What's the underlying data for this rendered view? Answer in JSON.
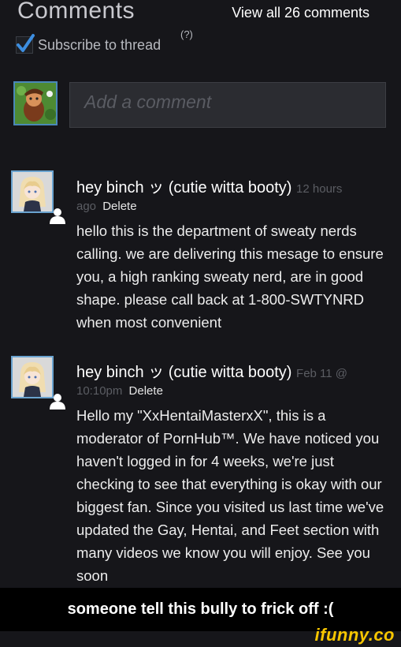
{
  "header": {
    "title": "Comments",
    "view_all": "View all 26 comments",
    "subscribe_label": "Subscribe to thread",
    "help": "(?)"
  },
  "composer": {
    "placeholder": "Add a comment"
  },
  "comments": [
    {
      "author": "hey binch ッ (cutie witta booty)",
      "timestamp_part1": "12 hours",
      "timestamp_part2": "ago",
      "delete_label": "Delete",
      "body": "hello this is the department of sweaty nerds calling. we are delivering this mesage to ensure you, a high ranking sweaty nerd, are in good shape. please call back at 1-800-SWTYNRD when most convenient"
    },
    {
      "author": "hey binch ッ (cutie witta booty)",
      "timestamp_part1": "Feb 11 @",
      "timestamp_part2": "10:10pm",
      "delete_label": "Delete",
      "body": "Hello my \"XxHentaiMasterxX\", this is a moderator of PornHub™. We have noticed you haven't logged in for 4 weeks, we're just checking to see that everything is okay with our biggest fan. Since you visited us last time we've updated the Gay, Hentai, and Feet section with many videos we know you will enjoy. See you soon"
    }
  ],
  "caption": "someone tell this bully to frick off :(",
  "watermark": "ifunny.co"
}
